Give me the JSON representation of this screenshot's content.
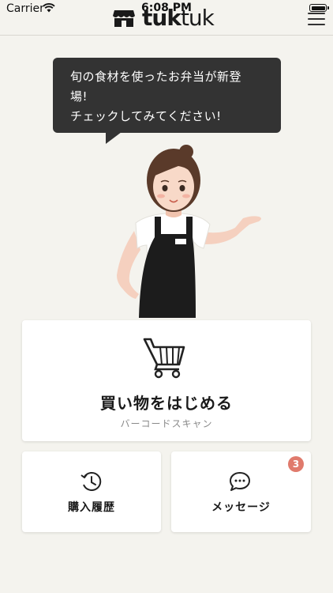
{
  "status_bar": {
    "carrier": "Carrier",
    "time": "6:08 PM"
  },
  "header": {
    "logo_bold": "tuk",
    "logo_thin": "tuk",
    "menu_icon": "hamburger-icon"
  },
  "bubble": {
    "lines": [
      "旬の食材を使ったお弁当が新登",
      "場!",
      "チェックしてみてください!"
    ]
  },
  "shopping_card": {
    "icon": "shopping-cart-icon",
    "title": "買い物をはじめる",
    "subtitle": "バーコードスキャン"
  },
  "history_card": {
    "icon": "history-clock-icon",
    "label": "購入履歴"
  },
  "message_card": {
    "icon": "chat-bubble-icon",
    "label": "メッセージ",
    "badge_count": "3"
  },
  "colors": {
    "background": "#f4f3ee",
    "bubble": "#333333",
    "badge": "#e07a6c",
    "card": "#ffffff"
  }
}
